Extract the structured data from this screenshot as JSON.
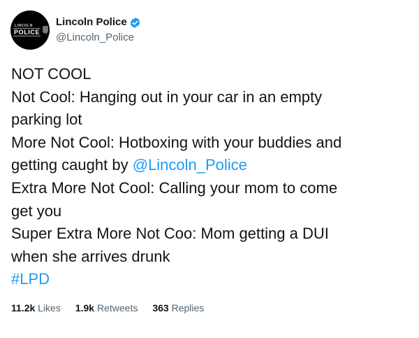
{
  "account": {
    "display_name": "Lincoln Police",
    "handle": "@Lincoln_Police",
    "avatar_text_top": "LINCOLN",
    "avatar_text_main": "POLICE",
    "verified": true,
    "verified_color": "#1d9bf0"
  },
  "tweet": {
    "line_1": "NOT COOL",
    "line_2": "Not Cool: Hanging out in your car in an empty",
    "line_3": "parking lot",
    "line_4": "More Not Cool: Hotboxing with your buddies and",
    "line_5_prefix": "getting caught by ",
    "line_5_mention": "@Lincoln_Police",
    "line_6": "Extra More Not Cool: Calling your mom to come",
    "line_7": "get you",
    "line_8": "Super Extra More Not Coo: Mom getting a DUI",
    "line_9": "when she arrives drunk",
    "hashtag": "#LPD"
  },
  "stats": {
    "likes_count": "11.2k",
    "likes_label": "Likes",
    "retweets_count": "1.9k",
    "retweets_label": "Retweets",
    "replies_count": "363",
    "replies_label": "Replies"
  },
  "colors": {
    "link": "#1d9bf0",
    "text": "#0f1419",
    "secondary": "#536471"
  }
}
